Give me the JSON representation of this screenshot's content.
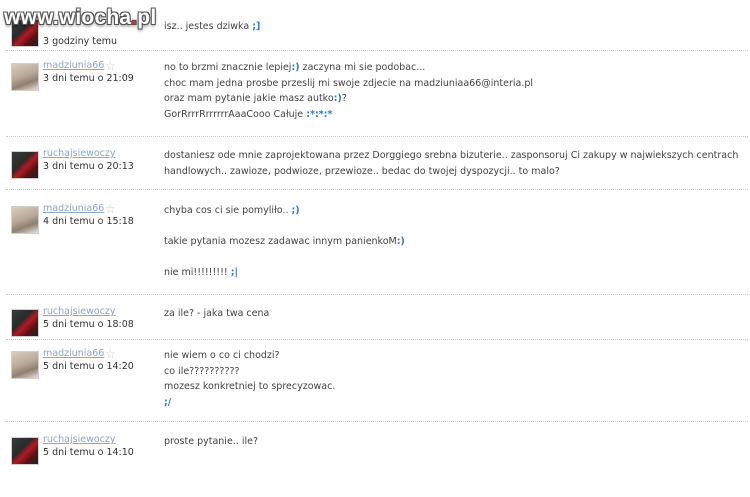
{
  "watermark": "www.wiocha.pl",
  "messages": [
    {
      "user": "",
      "time": "3 godziny temu",
      "lines": [
        "isz.. jestes dziwka ;]"
      ],
      "avatar": "red"
    },
    {
      "user": "madziunia66",
      "time": "3 dni temu o 21:09",
      "lines": [
        "no to brzmi znacznie lepiej:) zaczyna mi sie podobac...",
        "choc mam jedna prosbe przeslij mi swoje zdjecie na madziuniaa66@interia.pl",
        "oraz mam pytanie jakie masz autko:)?",
        "GorRrrrRrrrrrrAaaCooo Całuje :*:*:*"
      ],
      "avatar": "photo"
    },
    {
      "user": "ruchajsiewoczy",
      "time": "3 dni temu o 20:13",
      "lines": [
        "dostaniesz ode mnie zaprojektowana przez Dorggiego srebna bizuterie.. zasponsoruj Ci zakupy w najwiekszych centrach handlowych.. zawioze, podwioze, przewioze.. bedac do twojej dyspozycji.. to malo?"
      ],
      "avatar": "red"
    },
    {
      "user": "madziunia66",
      "time": "4 dni temu o 15:18",
      "lines": [
        "chyba cos ci sie pomyliło.. ;)",
        "",
        "takie pytania mozesz zadawac innym panienkoM:)",
        "",
        "nie mi!!!!!!!!! ;|"
      ],
      "avatar": "photo"
    },
    {
      "user": "ruchajsiewoczy",
      "time": "5 dni temu o 18:08",
      "lines": [
        "za ile? - jaka twa cena"
      ],
      "avatar": "red"
    },
    {
      "user": "madziunia66",
      "time": "5 dni temu o 14:20",
      "lines": [
        "nie wiem o co ci chodzi?",
        "co ile??????????",
        "mozesz konkretniej to sprecyzowac.",
        ";/"
      ],
      "avatar": "photo"
    },
    {
      "user": "ruchajsiewoczy",
      "time": "5 dni temu o 14:10",
      "lines": [
        "proste pytanie.. ile?"
      ],
      "avatar": "red"
    }
  ]
}
